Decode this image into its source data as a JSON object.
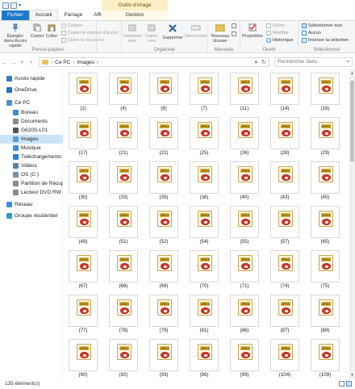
{
  "titlebar": {
    "context_tool": "Outils d’image"
  },
  "tabs": {
    "fichier": "Fichier",
    "accueil": "Accueil",
    "partage": "Partage",
    "affichage": "Affichage",
    "gestion": "Gestion"
  },
  "ribbon": {
    "pin": "Épingler dans Accès rapide",
    "copy": "Copier",
    "paste": "Coller",
    "cut": "Couper",
    "copy_path": "Copier le chemin d’accès",
    "paste_shortcut": "Coller le raccourci",
    "group_clipboard": "Presse-papiers",
    "move": "Déplacer vers",
    "copy_to": "Copier vers",
    "delete": "Supprimer",
    "rename": "Renommer",
    "group_organize": "Organiser",
    "new_folder": "Nouveau dossier",
    "group_new": "Nouveau",
    "properties": "Propriétés",
    "open": "Ouvrir",
    "modify": "Modifier",
    "history": "Historique",
    "group_open": "Ouvrir",
    "select_all": "Sélectionner tout",
    "select_none": "Aucun",
    "invert": "Inverser la sélection",
    "group_select": "Sélectionner"
  },
  "address": {
    "pc": "Ce PC",
    "folder": "Images",
    "sep": "›"
  },
  "search": {
    "placeholder": "Rechercher dans :"
  },
  "nav": [
    {
      "label": "Accès rapide",
      "color": "#2f7bd0"
    },
    {
      "label": "OneDrive",
      "color": "#1e6fc9"
    },
    {
      "label": "Ce PC",
      "color": "#4a8fd6"
    },
    {
      "label": "Bureau",
      "color": "#3c8fd6"
    },
    {
      "label": "Documents",
      "color": "#8a8a8a"
    },
    {
      "label": "G620S-L01",
      "color": "#555555"
    },
    {
      "label": "Images",
      "color": "#5b9bd5"
    },
    {
      "label": "Musique",
      "color": "#3c8fd6"
    },
    {
      "label": "Téléchargements",
      "color": "#2f7bd0"
    },
    {
      "label": "Vidéos",
      "color": "#5b7fa6"
    },
    {
      "label": "OS (C:)",
      "color": "#6f8fb0"
    },
    {
      "label": "Partition de Récupé",
      "color": "#8a8a8a"
    },
    {
      "label": "Lecteur DVD RW (E:",
      "color": "#8a8a8a"
    },
    {
      "label": "Réseau",
      "color": "#3c8fd6"
    },
    {
      "label": "Groupe résidentiel",
      "color": "#2f9bd0"
    }
  ],
  "files": [
    "(2)",
    "(4)",
    "(6)",
    "(7)",
    "(11)",
    "(14)",
    "(16)",
    "(17)",
    "(21)",
    "(22)",
    "(25)",
    "(26)",
    "(28)",
    "(29)",
    "(30)",
    "(33)",
    "(35)",
    "(38)",
    "(40)",
    "(43)",
    "(45)",
    "(49)",
    "(51)",
    "(52)",
    "(54)",
    "(55)",
    "(57)",
    "(65)",
    "(67)",
    "(68)",
    "(69)",
    "(70)",
    "(71)",
    "(74)",
    "(75)",
    "(77)",
    "(78)",
    "(79)",
    "(81)",
    "(86)",
    "(87)",
    "(89)",
    "(90)",
    "(92)",
    "(93)",
    "(96)",
    "(99)",
    "(104)",
    "(109)"
  ],
  "file_badge": "JPEG",
  "status": {
    "count": "135 élément(s)"
  }
}
